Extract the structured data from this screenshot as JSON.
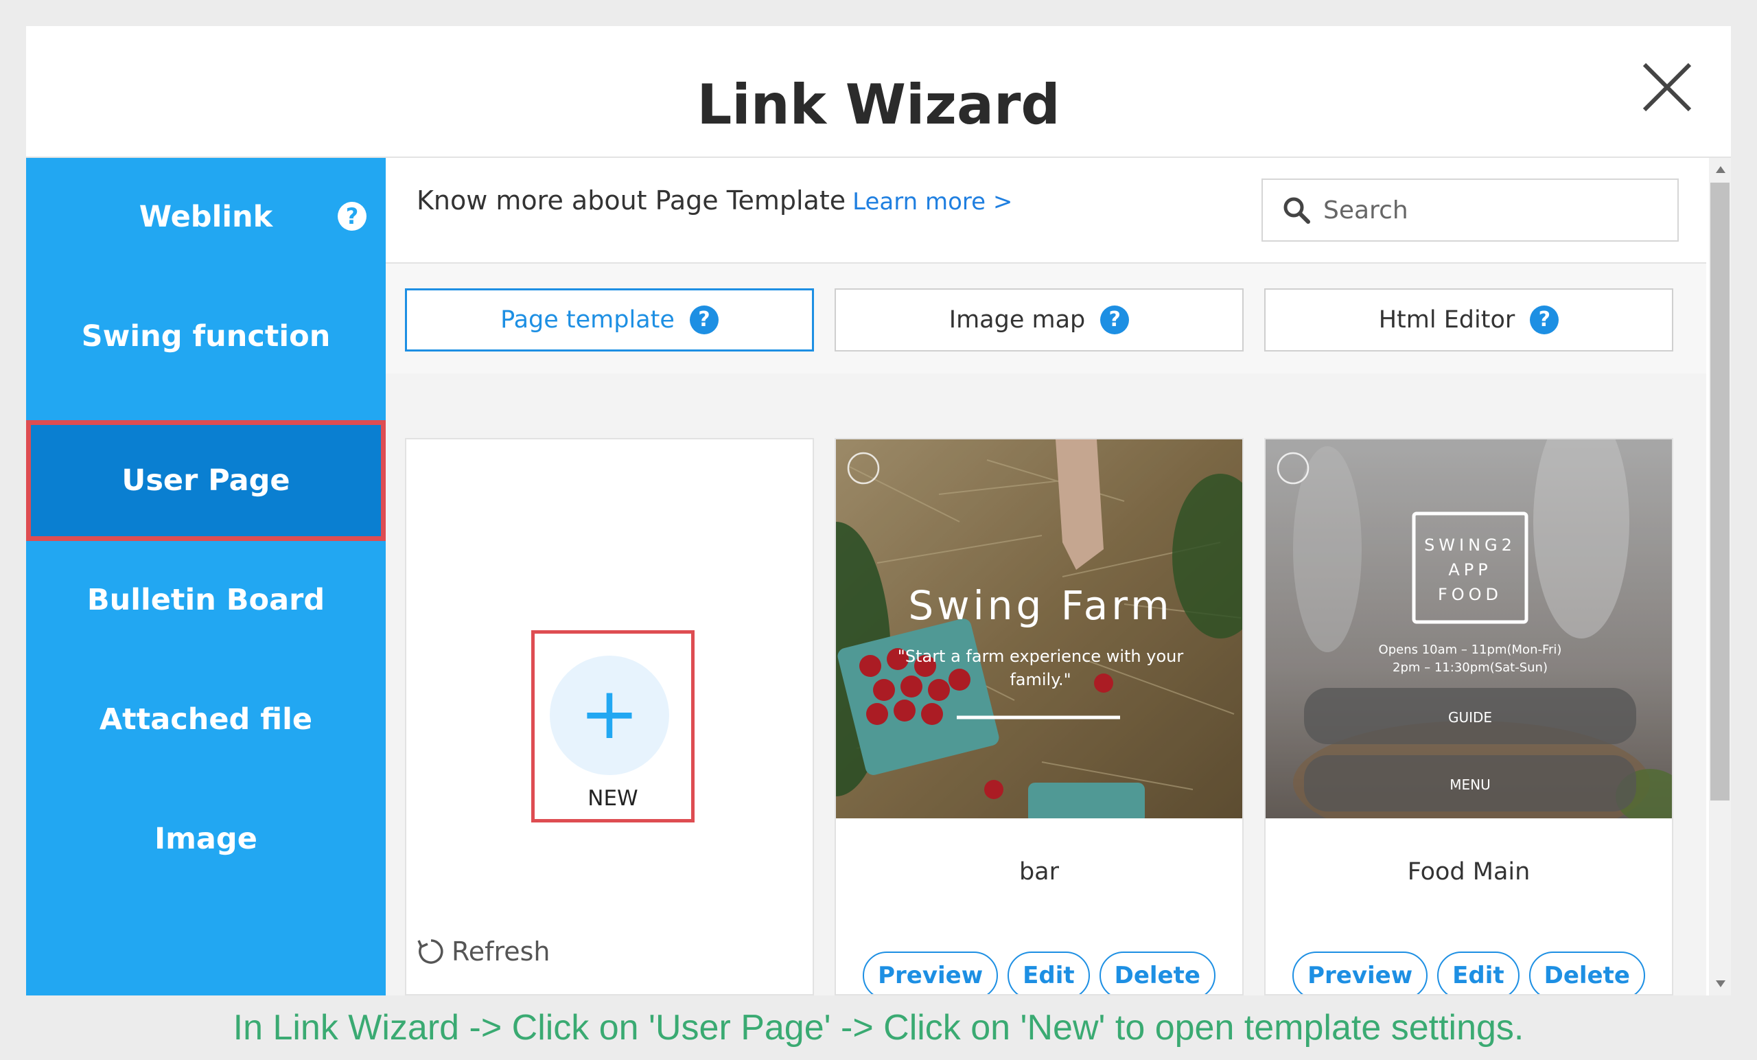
{
  "dialog": {
    "title": "Link Wizard",
    "close_icon": "close-icon"
  },
  "sidebar": {
    "items": [
      {
        "label": "Weblink",
        "has_help": true
      },
      {
        "label": "Swing function"
      },
      {
        "label": "User Page",
        "active": true
      },
      {
        "label": "Bulletin Board"
      },
      {
        "label": "Attached file"
      },
      {
        "label": "Image"
      }
    ],
    "help_glyph": "?"
  },
  "topbar": {
    "info_text": "Know more about Page Template",
    "learn_more": "Learn more >",
    "search_placeholder": "Search"
  },
  "tabs": [
    {
      "label": "Page template",
      "active": true,
      "help": "?"
    },
    {
      "label": "Image map",
      "help": "?"
    },
    {
      "label": "Html Editor",
      "help": "?"
    }
  ],
  "new_card": {
    "plus": "+",
    "label": "NEW",
    "refresh_label": "Refresh"
  },
  "templates": [
    {
      "name": "bar",
      "thumb": {
        "headline": "Swing Farm",
        "tagline_line1": "\"Start a farm experience with your",
        "tagline_line2": "family.\""
      },
      "actions": [
        "Preview",
        "Edit",
        "Delete"
      ]
    },
    {
      "name": "Food Main",
      "thumb": {
        "logo_line1": "SWING2",
        "logo_line2": "APP",
        "logo_line3": "FOOD",
        "hours_line1": "Opens 10am – 11pm(Mon-Fri)",
        "hours_line2": "2pm – 11:30pm(Sat-Sun)",
        "button1": "GUIDE",
        "button2": "MENU"
      },
      "actions": [
        "Preview",
        "Edit",
        "Delete"
      ]
    }
  ],
  "caption": "In Link Wizard -> Click on 'User Page' -> Click on 'New' to open template settings.",
  "colors": {
    "sidebar_bg": "#22a7f2",
    "sidebar_active": "#0a7fd1",
    "highlight_border": "#de4d52",
    "accent_blue": "#1d8fe3",
    "caption_green": "#3aaa72"
  }
}
